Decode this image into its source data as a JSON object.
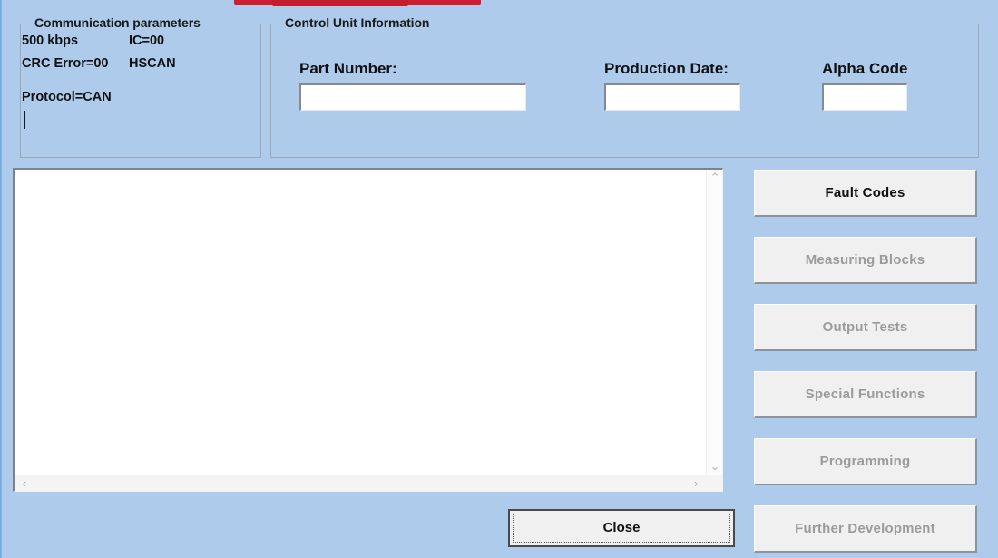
{
  "window": {
    "background_color": "#aecbec",
    "titlebar_accent_color": "#cc2030"
  },
  "communication_parameters": {
    "title": "Communication parameters",
    "rows": [
      {
        "left": "500 kbps",
        "right": "IC=00"
      },
      {
        "left": "CRC Error=00",
        "right": "HSCAN"
      }
    ],
    "protocol": "Protocol=CAN",
    "caret_visible": true
  },
  "control_unit_information": {
    "title": "Control Unit Information",
    "fields": [
      {
        "label": "Part Number:",
        "value": "",
        "placeholder": ""
      },
      {
        "label": "Production Date:",
        "value": "",
        "placeholder": ""
      },
      {
        "label": "Alpha Code",
        "value": "",
        "placeholder": ""
      }
    ]
  },
  "output": {
    "text": "",
    "scrollbar_v": {
      "up_icon": "⌃",
      "down_icon": "⌄"
    },
    "scrollbar_h": {
      "left_icon": "‹",
      "right_icon": "›"
    }
  },
  "function_buttons": [
    {
      "label": "Fault Codes",
      "enabled": true
    },
    {
      "label": "Measuring Blocks",
      "enabled": false
    },
    {
      "label": "Output Tests",
      "enabled": false
    },
    {
      "label": "Special Functions",
      "enabled": false
    },
    {
      "label": "Programming",
      "enabled": false
    },
    {
      "label": "Further Development",
      "enabled": false
    }
  ],
  "close_button": {
    "label": "Close",
    "focused": true
  }
}
